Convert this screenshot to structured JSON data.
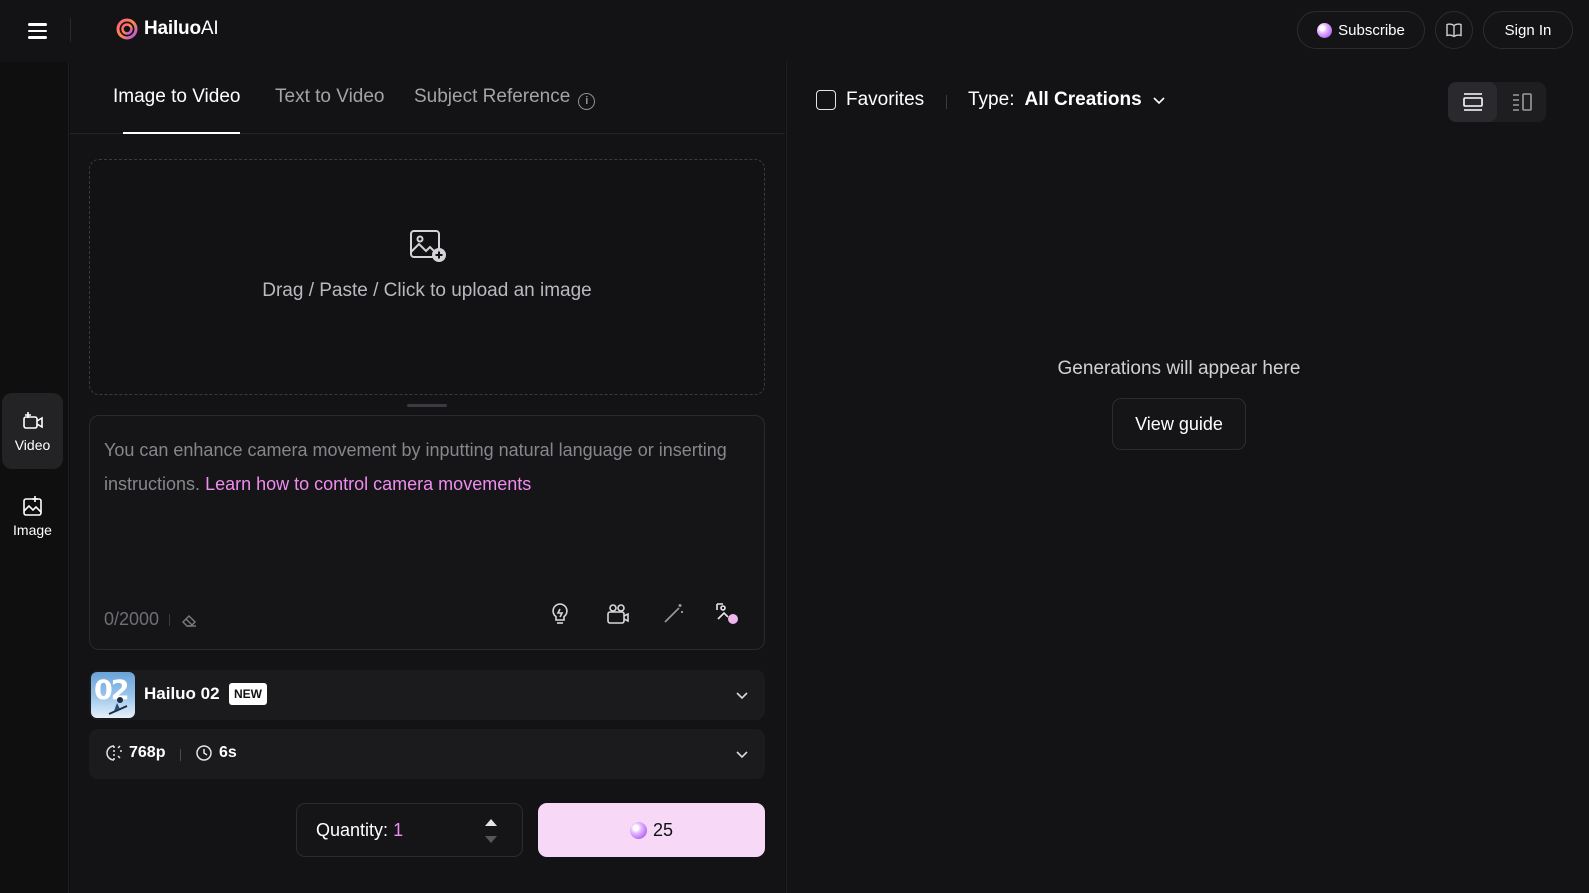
{
  "app": {
    "brand": "Hailuo",
    "brand_suffix": "AI"
  },
  "header": {
    "subscribe_label": "Subscribe",
    "signin_label": "Sign In"
  },
  "rail": {
    "items": [
      {
        "label": "Video",
        "icon": "video-add-icon",
        "active": true
      },
      {
        "label": "Image",
        "icon": "image-add-icon",
        "active": false
      }
    ]
  },
  "tabs": [
    {
      "label": "Image to Video",
      "active": true
    },
    {
      "label": "Text to Video",
      "active": false
    },
    {
      "label": "Subject Reference",
      "active": false
    }
  ],
  "upload": {
    "text": "Drag / Paste / Click to upload an image"
  },
  "prompt": {
    "placeholder": "You can enhance camera movement by inputting natural language or inserting instructions.",
    "link": "Learn how to control camera movements",
    "counter": "0/2000"
  },
  "prompt_tools": [
    "bulb-icon",
    "camera-icon",
    "magic-wand-icon",
    "image-style-icon"
  ],
  "model": {
    "thumb_text": "02",
    "name": "Hailuo 02",
    "badge": "NEW"
  },
  "settings": {
    "resolution": "768p",
    "duration": "6s"
  },
  "quantity": {
    "label": "Quantity:",
    "value": "1"
  },
  "generate": {
    "cost": "25"
  },
  "results": {
    "favorites_label": "Favorites",
    "type_label": "Type:",
    "type_value": "All Creations",
    "empty_message": "Generations will appear here",
    "guide_label": "View guide"
  },
  "colors": {
    "accent": "#f08cf0",
    "generate_bg": "#f7d8f6",
    "bg": "#131315"
  }
}
